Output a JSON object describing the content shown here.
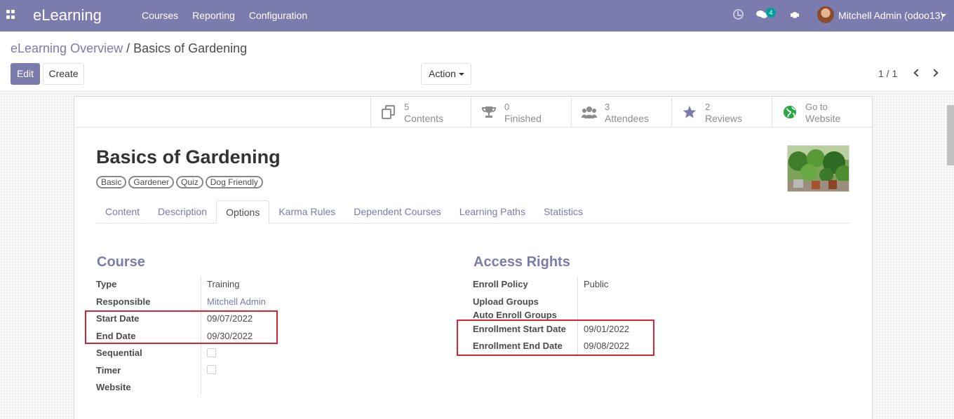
{
  "navbar": {
    "brand": "eLearning",
    "menu": [
      "Courses",
      "Reporting",
      "Configuration"
    ],
    "chat_count": "4",
    "user": "Mitchell Admin (odoo13)"
  },
  "breadcrumb": {
    "parent": "eLearning Overview",
    "separator": "/",
    "current": "Basics of Gardening"
  },
  "buttons": {
    "edit": "Edit",
    "create": "Create",
    "action": "Action"
  },
  "pager": "1 / 1",
  "stats": [
    {
      "value": "5",
      "label": "Contents",
      "icon": "copy-icon"
    },
    {
      "value": "0",
      "label": "Finished",
      "icon": "trophy-icon"
    },
    {
      "value": "3",
      "label": "Attendees",
      "icon": "users-icon"
    },
    {
      "value": "2",
      "label": "Reviews",
      "icon": "star-icon"
    },
    {
      "value": "Go to",
      "label": "Website",
      "icon": "globe-icon"
    }
  ],
  "course": {
    "title": "Basics of Gardening",
    "tags": [
      "Basic",
      "Gardener",
      "Quiz",
      "Dog Friendly"
    ]
  },
  "tabs": [
    "Content",
    "Description",
    "Options",
    "Karma Rules",
    "Dependent Courses",
    "Learning Paths",
    "Statistics"
  ],
  "active_tab": "Options",
  "course_group": {
    "title": "Course",
    "fields": [
      {
        "label": "Type",
        "value": "Training"
      },
      {
        "label": "Responsible",
        "value": "Mitchell Admin"
      },
      {
        "label": "Start Date",
        "value": "09/07/2022"
      },
      {
        "label": "End Date",
        "value": "09/30/2022"
      },
      {
        "label": "Sequential",
        "value": ""
      },
      {
        "label": "Timer",
        "value": ""
      },
      {
        "label": "Website",
        "value": ""
      }
    ]
  },
  "access_group": {
    "title": "Access Rights",
    "fields": [
      {
        "label": "Enroll Policy",
        "value": "Public"
      },
      {
        "label": "Upload Groups",
        "value": ""
      },
      {
        "label": "Auto Enroll Groups",
        "value": ""
      },
      {
        "label": "Enrollment Start Date",
        "value": "09/01/2022"
      },
      {
        "label": "Enrollment End Date",
        "value": "09/08/2022"
      }
    ]
  },
  "colors": {
    "brand": "#7c7bad",
    "highlight": "#d9232e",
    "badge": "#00a09d"
  }
}
